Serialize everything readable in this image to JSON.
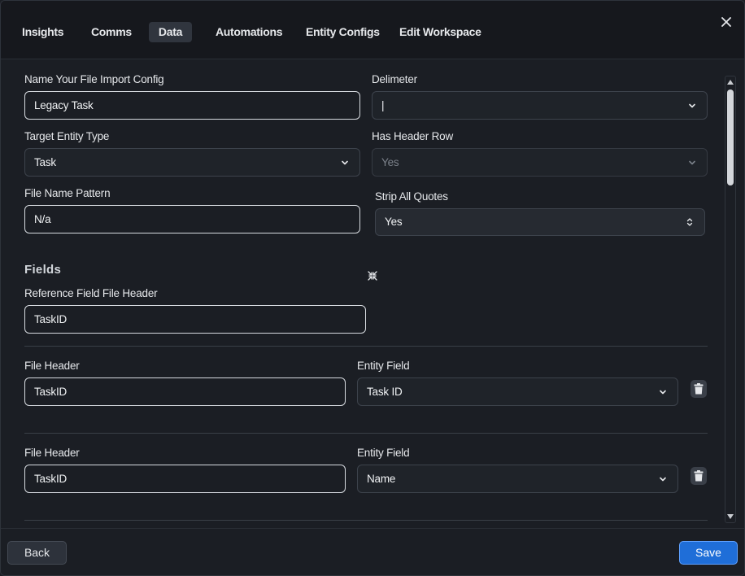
{
  "tabs": [
    "Insights",
    "Comms",
    "Data",
    "Automations",
    "Entity Configs",
    "Edit Workspace"
  ],
  "active_tab": "Data",
  "form": {
    "config_name_label": "Name Your File Import Config",
    "config_name_value": "Legacy Task",
    "delimeter_label": "Delimeter",
    "delimeter_value": "|",
    "target_entity_label": "Target Entity Type",
    "target_entity_value": "Task",
    "has_header_label": "Has Header Row",
    "has_header_value": "Yes",
    "file_pattern_label": "File Name Pattern",
    "file_pattern_value": "N/a",
    "strip_quotes_label": "Strip All Quotes",
    "strip_quotes_value": "Yes"
  },
  "fields_section": {
    "title": "Fields",
    "reference_label": "Reference Field File Header",
    "reference_value": "TaskID",
    "mappings": [
      {
        "file_header_label": "File Header",
        "file_header_value": "TaskID",
        "entity_field_label": "Entity Field",
        "entity_field_value": "Task ID"
      },
      {
        "file_header_label": "File Header",
        "file_header_value": "TaskID",
        "entity_field_label": "Entity Field",
        "entity_field_value": "Name"
      }
    ]
  },
  "footer": {
    "back_label": "Back",
    "save_label": "Save"
  },
  "icons": {
    "close": "close-icon",
    "chevron": "chevron-down-icon",
    "trash": "trash-icon",
    "collapse": "collapse-icon"
  },
  "colors": {
    "background": "#1b1e24",
    "header": "#16181d",
    "accent": "#1f6ed8"
  }
}
